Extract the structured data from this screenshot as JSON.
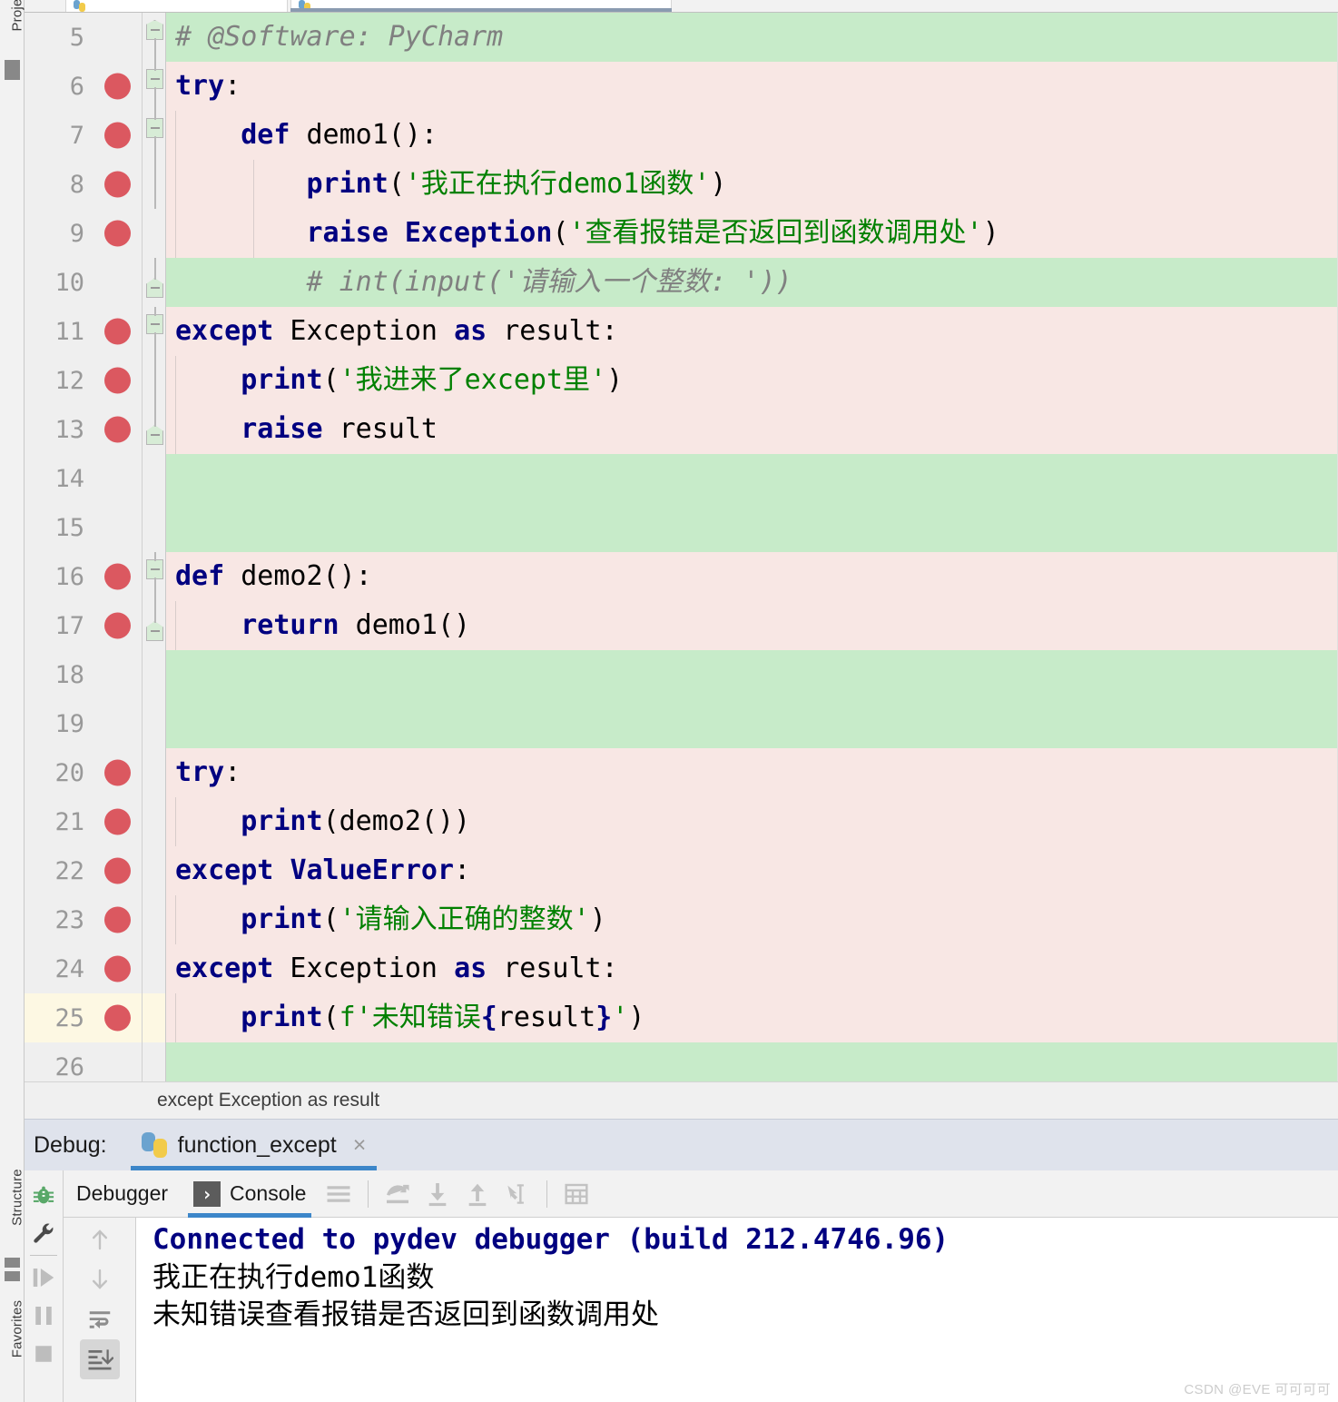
{
  "window": {
    "left_stripe": [
      "Project",
      "Structure",
      "Favorites"
    ]
  },
  "editor_tabs": [
    {
      "label": "",
      "icon": "python-file-icon",
      "active": false
    },
    {
      "label": "",
      "icon": "python-file-icon",
      "active": true
    }
  ],
  "editor": {
    "lines": [
      {
        "num": "5",
        "bg": "green",
        "bp": false,
        "fold": "start",
        "indent_guides": 0,
        "tokens": [
          {
            "t": "# @Software: PyCharm",
            "c": "cmt"
          }
        ]
      },
      {
        "num": "6",
        "bg": "pink",
        "bp": true,
        "fold": "mid",
        "indent_guides": 0,
        "tokens": [
          {
            "t": "try",
            "c": "kw"
          },
          {
            "t": ":",
            "c": "plain"
          }
        ]
      },
      {
        "num": "7",
        "bg": "pink",
        "bp": true,
        "fold": "mid",
        "indent_guides": 1,
        "tokens": [
          {
            "t": "    ",
            "c": "plain"
          },
          {
            "t": "def",
            "c": "kw"
          },
          {
            "t": " demo1():",
            "c": "plain"
          }
        ]
      },
      {
        "num": "8",
        "bg": "pink",
        "bp": true,
        "fold": "none",
        "indent_guides": 2,
        "tokens": [
          {
            "t": "        ",
            "c": "plain"
          },
          {
            "t": "print",
            "c": "kw"
          },
          {
            "t": "(",
            "c": "plain"
          },
          {
            "t": "'我正在执行demo1函数'",
            "c": "str"
          },
          {
            "t": ")",
            "c": "plain"
          }
        ]
      },
      {
        "num": "9",
        "bg": "pink",
        "bp": true,
        "fold": "none",
        "indent_guides": 2,
        "tokens": [
          {
            "t": "        ",
            "c": "plain"
          },
          {
            "t": "raise",
            "c": "kw"
          },
          {
            "t": " ",
            "c": "plain"
          },
          {
            "t": "Exception",
            "c": "kw"
          },
          {
            "t": "(",
            "c": "plain"
          },
          {
            "t": "'查看报错是否返回到函数调用处'",
            "c": "str"
          },
          {
            "t": ")",
            "c": "plain"
          }
        ]
      },
      {
        "num": "10",
        "bg": "green",
        "bp": false,
        "fold": "end",
        "indent_guides": 0,
        "tokens": [
          {
            "t": "        # int(input('请输入一个整数: '))",
            "c": "cmt"
          }
        ]
      },
      {
        "num": "11",
        "bg": "pink",
        "bp": true,
        "fold": "mid",
        "indent_guides": 0,
        "tokens": [
          {
            "t": "except",
            "c": "kw"
          },
          {
            "t": " Exception ",
            "c": "plain"
          },
          {
            "t": "as",
            "c": "kw"
          },
          {
            "t": " result:",
            "c": "plain"
          }
        ]
      },
      {
        "num": "12",
        "bg": "pink",
        "bp": true,
        "fold": "none",
        "indent_guides": 1,
        "tokens": [
          {
            "t": "    ",
            "c": "plain"
          },
          {
            "t": "print",
            "c": "kw"
          },
          {
            "t": "(",
            "c": "plain"
          },
          {
            "t": "'我进来了except里'",
            "c": "str"
          },
          {
            "t": ")",
            "c": "plain"
          }
        ]
      },
      {
        "num": "13",
        "bg": "pink",
        "bp": true,
        "fold": "end",
        "indent_guides": 1,
        "tokens": [
          {
            "t": "    ",
            "c": "plain"
          },
          {
            "t": "raise",
            "c": "kw"
          },
          {
            "t": " result",
            "c": "plain"
          }
        ]
      },
      {
        "num": "14",
        "bg": "green",
        "bp": false,
        "fold": "none",
        "indent_guides": 0,
        "tokens": []
      },
      {
        "num": "15",
        "bg": "green",
        "bp": false,
        "fold": "none",
        "indent_guides": 0,
        "tokens": []
      },
      {
        "num": "16",
        "bg": "pink",
        "bp": true,
        "fold": "mid",
        "indent_guides": 0,
        "tokens": [
          {
            "t": "def",
            "c": "kw"
          },
          {
            "t": " demo2():",
            "c": "plain"
          }
        ]
      },
      {
        "num": "17",
        "bg": "pink",
        "bp": true,
        "fold": "end",
        "indent_guides": 1,
        "tokens": [
          {
            "t": "    ",
            "c": "plain"
          },
          {
            "t": "return",
            "c": "kw"
          },
          {
            "t": " demo1()",
            "c": "plain"
          }
        ]
      },
      {
        "num": "18",
        "bg": "green",
        "bp": false,
        "fold": "none",
        "indent_guides": 0,
        "tokens": []
      },
      {
        "num": "19",
        "bg": "green",
        "bp": false,
        "fold": "none",
        "indent_guides": 0,
        "tokens": []
      },
      {
        "num": "20",
        "bg": "pink",
        "bp": true,
        "fold": "none",
        "indent_guides": 0,
        "tokens": [
          {
            "t": "try",
            "c": "kw"
          },
          {
            "t": ":",
            "c": "plain"
          }
        ]
      },
      {
        "num": "21",
        "bg": "pink",
        "bp": true,
        "fold": "none",
        "indent_guides": 1,
        "tokens": [
          {
            "t": "    ",
            "c": "plain"
          },
          {
            "t": "print",
            "c": "kw"
          },
          {
            "t": "(demo2())",
            "c": "plain"
          }
        ]
      },
      {
        "num": "22",
        "bg": "pink",
        "bp": true,
        "fold": "none",
        "indent_guides": 0,
        "tokens": [
          {
            "t": "except",
            "c": "kw"
          },
          {
            "t": " ",
            "c": "plain"
          },
          {
            "t": "ValueError",
            "c": "kw"
          },
          {
            "t": ":",
            "c": "plain"
          }
        ]
      },
      {
        "num": "23",
        "bg": "pink",
        "bp": true,
        "fold": "none",
        "indent_guides": 1,
        "tokens": [
          {
            "t": "    ",
            "c": "plain"
          },
          {
            "t": "print",
            "c": "kw"
          },
          {
            "t": "(",
            "c": "plain"
          },
          {
            "t": "'请输入正确的整数'",
            "c": "str"
          },
          {
            "t": ")",
            "c": "plain"
          }
        ]
      },
      {
        "num": "24",
        "bg": "pink",
        "bp": true,
        "fold": "none",
        "indent_guides": 0,
        "tokens": [
          {
            "t": "except",
            "c": "kw"
          },
          {
            "t": " Exception ",
            "c": "plain"
          },
          {
            "t": "as",
            "c": "kw"
          },
          {
            "t": " result:",
            "c": "plain"
          }
        ]
      },
      {
        "num": "25",
        "bg": "pink",
        "bp": true,
        "fold": "none",
        "caret": true,
        "indent_guides": 1,
        "tokens": [
          {
            "t": "    ",
            "c": "plain"
          },
          {
            "t": "print",
            "c": "kw"
          },
          {
            "t": "(",
            "c": "plain"
          },
          {
            "t": "f",
            "c": "str"
          },
          {
            "t": "'未知错误",
            "c": "str"
          },
          {
            "t": "{",
            "c": "bracecol"
          },
          {
            "t": "result",
            "c": "plain"
          },
          {
            "t": "}",
            "c": "bracecol"
          },
          {
            "t": "'",
            "c": "str"
          },
          {
            "t": ")",
            "c": "plain"
          }
        ]
      },
      {
        "num": "26",
        "bg": "green",
        "bp": false,
        "fold": "none",
        "indent_guides": 0,
        "tokens": []
      }
    ]
  },
  "breadcrumb": {
    "text": "except Exception as result"
  },
  "debug_header": {
    "label": "Debug:",
    "tab_name": "function_except",
    "close_glyph": "×"
  },
  "debug_rail": [
    {
      "name": "debugger-bug-icon",
      "glyph": "bug"
    },
    {
      "name": "settings-wrench-icon",
      "glyph": "wrench"
    },
    {
      "name": "resume-program-button",
      "glyph": "resume"
    },
    {
      "name": "pause-program-button",
      "glyph": "pause"
    },
    {
      "name": "stop-program-button",
      "glyph": "stop"
    }
  ],
  "debug_tabs": [
    {
      "label": "Debugger",
      "selected": false,
      "icon": null
    },
    {
      "label": "Console",
      "selected": true,
      "icon": "console-terminal-icon"
    }
  ],
  "debug_toolbar": [
    {
      "name": "show-hide-lines-button",
      "glyph": "lines"
    },
    {
      "name": "step-over-button",
      "glyph": "step-over"
    },
    {
      "name": "step-into-button",
      "glyph": "step-into"
    },
    {
      "name": "step-out-button",
      "glyph": "step-out"
    },
    {
      "name": "run-to-cursor-button",
      "glyph": "run-to-cursor"
    },
    {
      "name": "evaluate-expression-button",
      "glyph": "table"
    }
  ],
  "console_gutter": [
    {
      "name": "scroll-up-button",
      "glyph": "up"
    },
    {
      "name": "scroll-down-button",
      "glyph": "down"
    },
    {
      "name": "soft-wrap-button",
      "glyph": "wrap"
    },
    {
      "name": "scroll-to-end-button",
      "glyph": "scroll-end",
      "active": true
    }
  ],
  "console_output": [
    {
      "text": "Connected to pydev debugger (build 212.4746.96)",
      "style": "blue"
    },
    {
      "text": "我正在执行demo1函数",
      "style": "black"
    },
    {
      "text": "未知错误查看报错是否返回到函数调用处",
      "style": "black"
    }
  ],
  "watermark": {
    "text": "CSDN @EVE 可可可可"
  },
  "colors": {
    "added_line_bg": "#c7ebc9",
    "modified_line_bg": "#f8e7e4",
    "breakpoint": "#db5860",
    "keyword": "#000080",
    "string": "#008000",
    "comment": "#808080",
    "tab_accent": "#3c86c9"
  }
}
